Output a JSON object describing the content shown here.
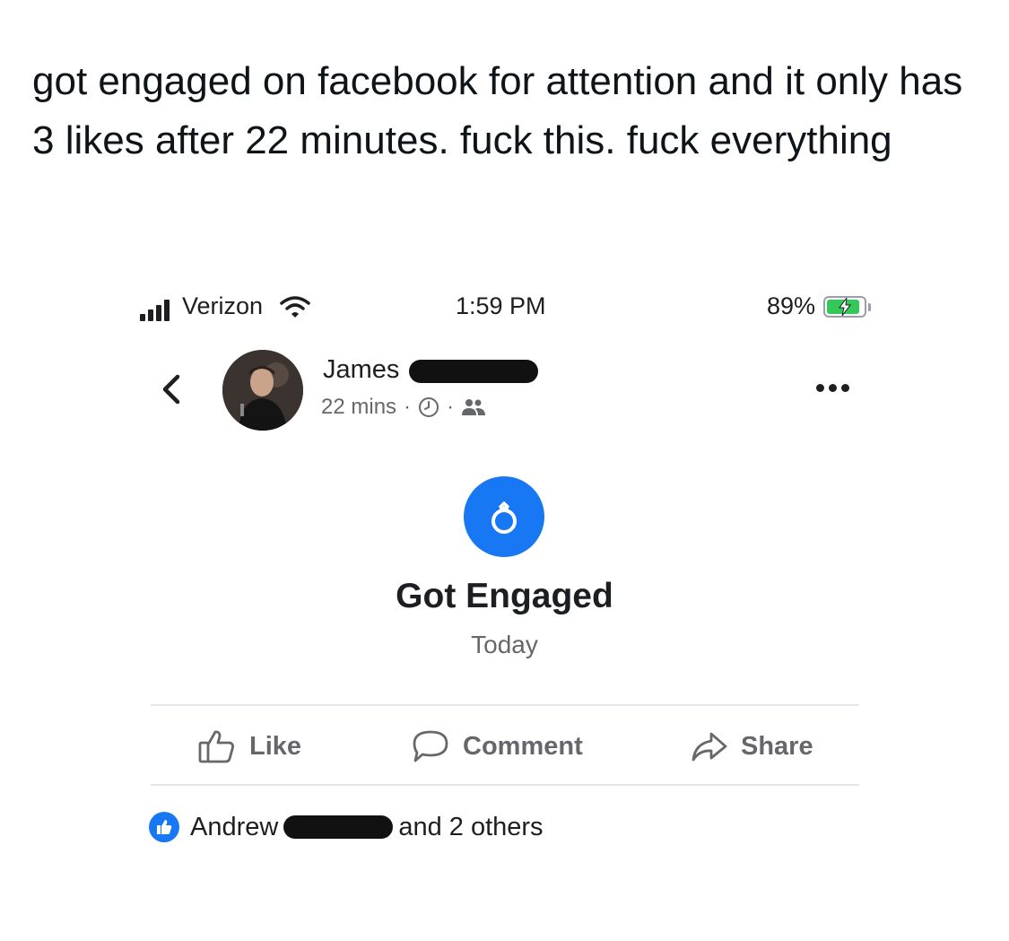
{
  "tweet": {
    "text": "got engaged on facebook for attention and it only has 3 likes after 22 minutes. fuck this. fuck everything"
  },
  "status_bar": {
    "carrier": "Verizon",
    "time": "1:59 PM",
    "battery": "89%",
    "battery_level": 0.89,
    "colors": {
      "battery_fill": "#34c759"
    }
  },
  "post": {
    "author_first_name": "James",
    "time_ago": "22 mins",
    "separator": "·",
    "icons": [
      "back-chevron-icon",
      "clock-icon",
      "friends-icon",
      "more-options-icon"
    ]
  },
  "life_event": {
    "icon": "ring-icon",
    "title": "Got Engaged",
    "date": "Today",
    "colors": {
      "icon_bg": "#1877f2"
    }
  },
  "actions": {
    "like": "Like",
    "comment": "Comment",
    "share": "Share"
  },
  "reactions": {
    "first_liker": "Andrew",
    "others": "and 2 others"
  }
}
